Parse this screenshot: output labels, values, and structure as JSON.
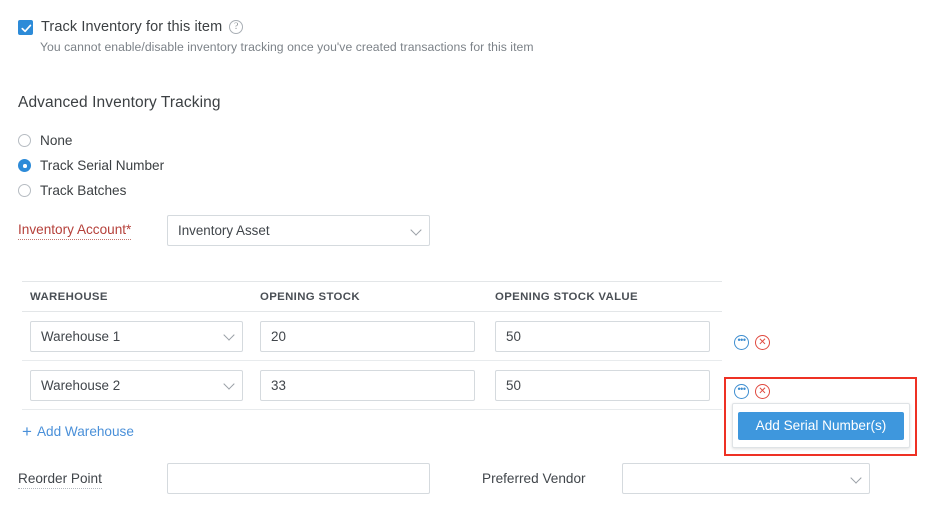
{
  "track_inventory": {
    "checked": true,
    "label": "Track Inventory for this item",
    "help_icon": "help-circle-icon",
    "help_glyph": "?",
    "note": "You cannot enable/disable inventory tracking once you've created transactions for this item"
  },
  "advanced_tracking": {
    "title": "Advanced Inventory Tracking",
    "selected": "Track Serial Number",
    "options": [
      {
        "label": "None",
        "selected": false
      },
      {
        "label": "Track Serial Number",
        "selected": true
      },
      {
        "label": "Track Batches",
        "selected": false
      }
    ]
  },
  "inventory_account": {
    "label": "Inventory Account*",
    "value": "Inventory Asset",
    "caret_icon": "chevron-down-icon"
  },
  "warehouse_table": {
    "columns": [
      "WAREHOUSE",
      "OPENING STOCK",
      "OPENING STOCK VALUE"
    ],
    "rows": [
      {
        "warehouse": "Warehouse 1",
        "opening_stock": "20",
        "opening_stock_value": "50",
        "more_icon": "ellipsis-circle-icon",
        "more_glyph": "•••",
        "delete_icon": "close-circle-icon",
        "delete_glyph": "✕"
      },
      {
        "warehouse": "Warehouse 2",
        "opening_stock": "33",
        "opening_stock_value": "50",
        "more_icon": "ellipsis-circle-icon",
        "more_glyph": "•••",
        "delete_icon": "close-circle-icon",
        "delete_glyph": "✕"
      }
    ],
    "add_row_label": "Add Warehouse",
    "add_row_icon": "plus-icon",
    "add_row_glyph": "+"
  },
  "serial_popup": {
    "button_label": "Add Serial Number(s)",
    "highlight_color": "#ee3124",
    "button_color": "#3e97dd"
  },
  "reorder_point": {
    "label": "Reorder Point",
    "value": "",
    "placeholder": ""
  },
  "preferred_vendor": {
    "label": "Preferred Vendor",
    "value": "",
    "caret_icon": "chevron-down-icon"
  },
  "colors": {
    "accent": "#2d8bd8",
    "link": "#4a90d9",
    "required_label": "#b5403a",
    "danger": "#e0493f",
    "annotation": "#ee3124"
  }
}
